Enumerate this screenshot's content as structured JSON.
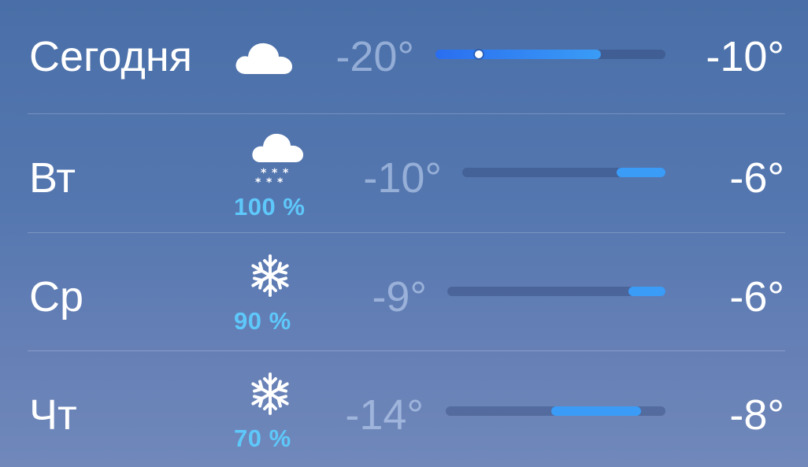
{
  "forecast": {
    "days": [
      {
        "day": "Сегодня",
        "icon": "cloud-icon",
        "precip": "",
        "low": "-20°",
        "high": "-10°",
        "range_start": 0.0,
        "range_end": 0.72,
        "current_position": 0.19
      },
      {
        "day": "Вт",
        "icon": "snow-cloud-icon",
        "precip": "100 %",
        "low": "-10°",
        "high": "-6°",
        "range_start": 0.76,
        "range_end": 1.0
      },
      {
        "day": "Ср",
        "icon": "snowflake-icon",
        "precip": "90 %",
        "low": "-9°",
        "high": "-6°",
        "range_start": 0.83,
        "range_end": 1.0
      },
      {
        "day": "Чт",
        "icon": "snowflake-icon",
        "precip": "70 %",
        "low": "-14°",
        "high": "-8°",
        "range_start": 0.48,
        "range_end": 0.89
      }
    ]
  },
  "colors": {
    "bar_fill": "#3a9cf6",
    "precip_text": "#5ec8fa"
  }
}
